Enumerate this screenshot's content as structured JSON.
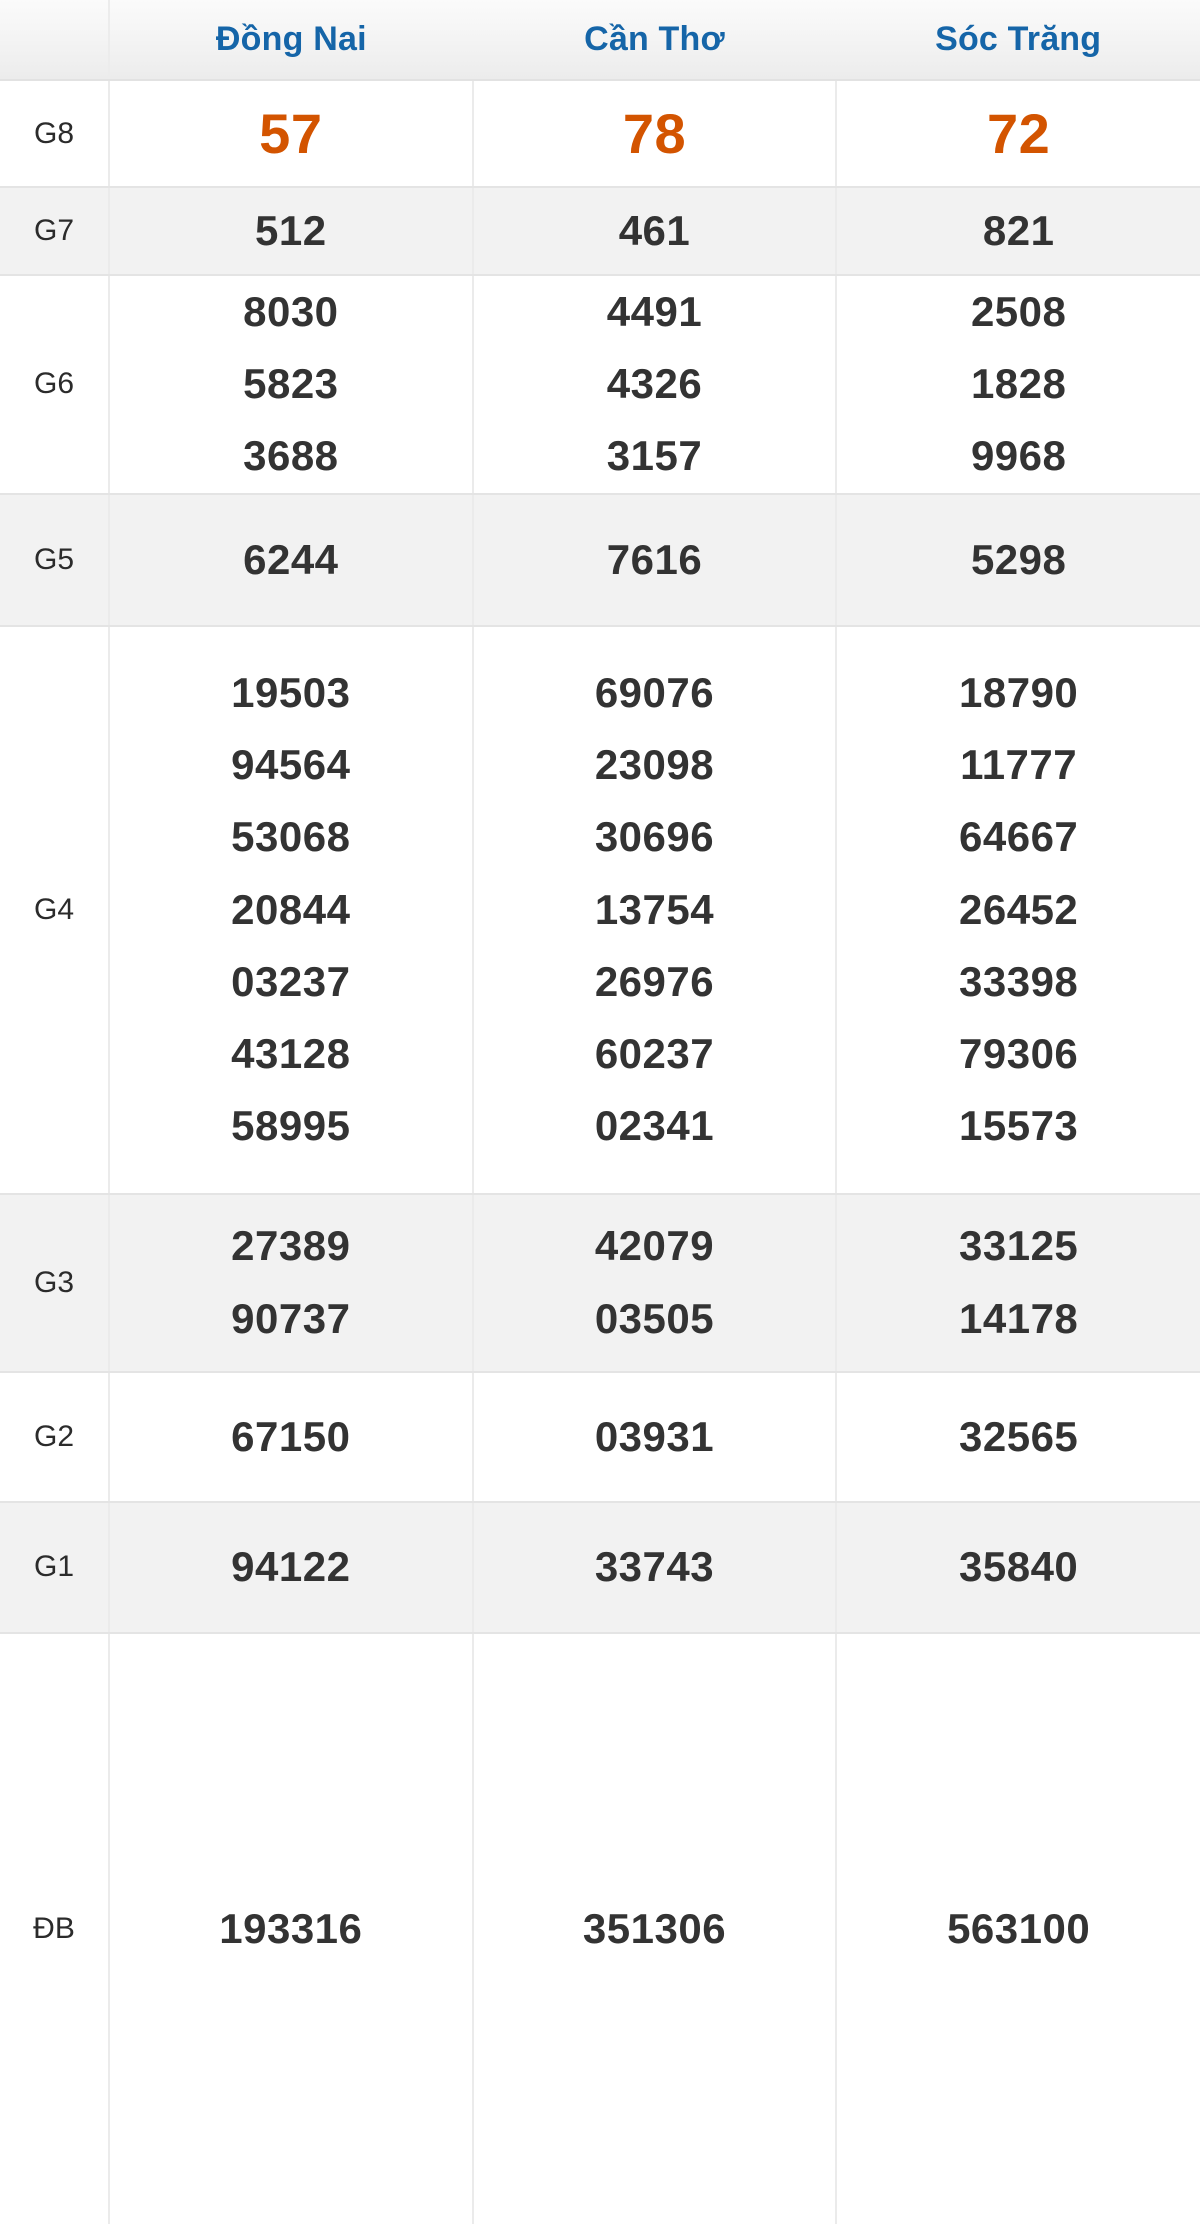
{
  "table": {
    "header": {
      "corner_label": "",
      "columns": [
        "Đồng Nai",
        "Cần Thơ",
        "Sóc Trăng"
      ]
    },
    "rows": [
      {
        "label": "G8",
        "style": "highlight-orange",
        "cells": [
          [
            "57"
          ],
          [
            "78"
          ],
          [
            "72"
          ]
        ]
      },
      {
        "label": "G7",
        "style": "normal",
        "cells": [
          [
            "512"
          ],
          [
            "461"
          ],
          [
            "821"
          ]
        ]
      },
      {
        "label": "G6",
        "style": "normal",
        "cells": [
          [
            "8030",
            "5823",
            "3688"
          ],
          [
            "4491",
            "4326",
            "3157"
          ],
          [
            "2508",
            "1828",
            "9968"
          ]
        ]
      },
      {
        "label": "G5",
        "style": "normal",
        "cells": [
          [
            "6244"
          ],
          [
            "7616"
          ],
          [
            "5298"
          ]
        ]
      },
      {
        "label": "G4",
        "style": "normal",
        "cells": [
          [
            "19503",
            "94564",
            "53068",
            "20844",
            "03237",
            "43128",
            "58995"
          ],
          [
            "69076",
            "23098",
            "30696",
            "13754",
            "26976",
            "60237",
            "02341"
          ],
          [
            "18790",
            "11777",
            "64667",
            "26452",
            "33398",
            "79306",
            "15573"
          ]
        ]
      },
      {
        "label": "G3",
        "style": "normal",
        "cells": [
          [
            "27389",
            "90737"
          ],
          [
            "42079",
            "03505"
          ],
          [
            "33125",
            "14178"
          ]
        ]
      },
      {
        "label": "G2",
        "style": "normal",
        "cells": [
          [
            "67150"
          ],
          [
            "03931"
          ],
          [
            "32565"
          ]
        ]
      },
      {
        "label": "G1",
        "style": "normal",
        "cells": [
          [
            "94122"
          ],
          [
            "33743"
          ],
          [
            "35840"
          ]
        ]
      },
      {
        "label": "ĐB",
        "style": "highlight-orange",
        "cells": [
          [
            "193316"
          ],
          [
            "351306"
          ],
          [
            "563100"
          ]
        ]
      }
    ]
  },
  "colors": {
    "header_text": "#1565a8",
    "highlight": "#d35400",
    "number_text": "#333333",
    "row_white": "#ffffff",
    "row_grey": "#f2f2f2",
    "border": "#e4e4e4"
  }
}
